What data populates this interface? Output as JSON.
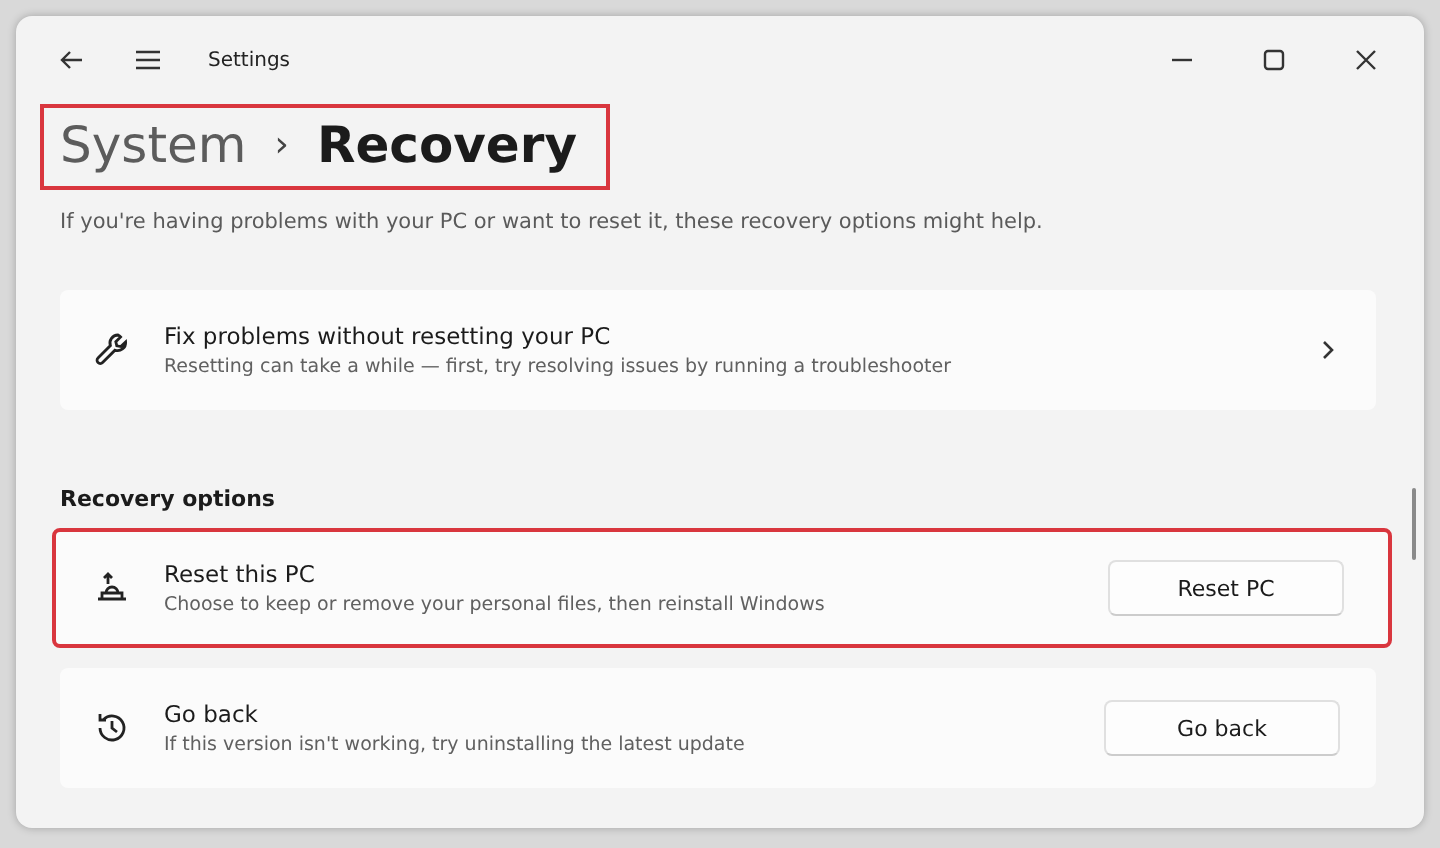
{
  "window": {
    "title": "Settings"
  },
  "breadcrumb": {
    "parent": "System",
    "separator": "›",
    "current": "Recovery",
    "highlighted": true
  },
  "description": "If you're having problems with your PC or want to reset it, these recovery options might help.",
  "top_cards": [
    {
      "kind": "link",
      "title": "Fix problems without resetting your PC",
      "subtitle": "Resetting can take a while — first, try resolving issues by running a troubleshooter",
      "highlighted": false
    }
  ],
  "section_title": "Recovery options",
  "option_cards": [
    {
      "kind": "button",
      "title": "Reset this PC",
      "subtitle": "Choose to keep or remove your personal files, then reinstall Windows",
      "button": "Reset PC",
      "highlighted": true
    },
    {
      "kind": "button",
      "title": "Go back",
      "subtitle": "If this version isn't working, try uninstalling the latest update",
      "button": "Go back",
      "highlighted": false
    }
  ]
}
